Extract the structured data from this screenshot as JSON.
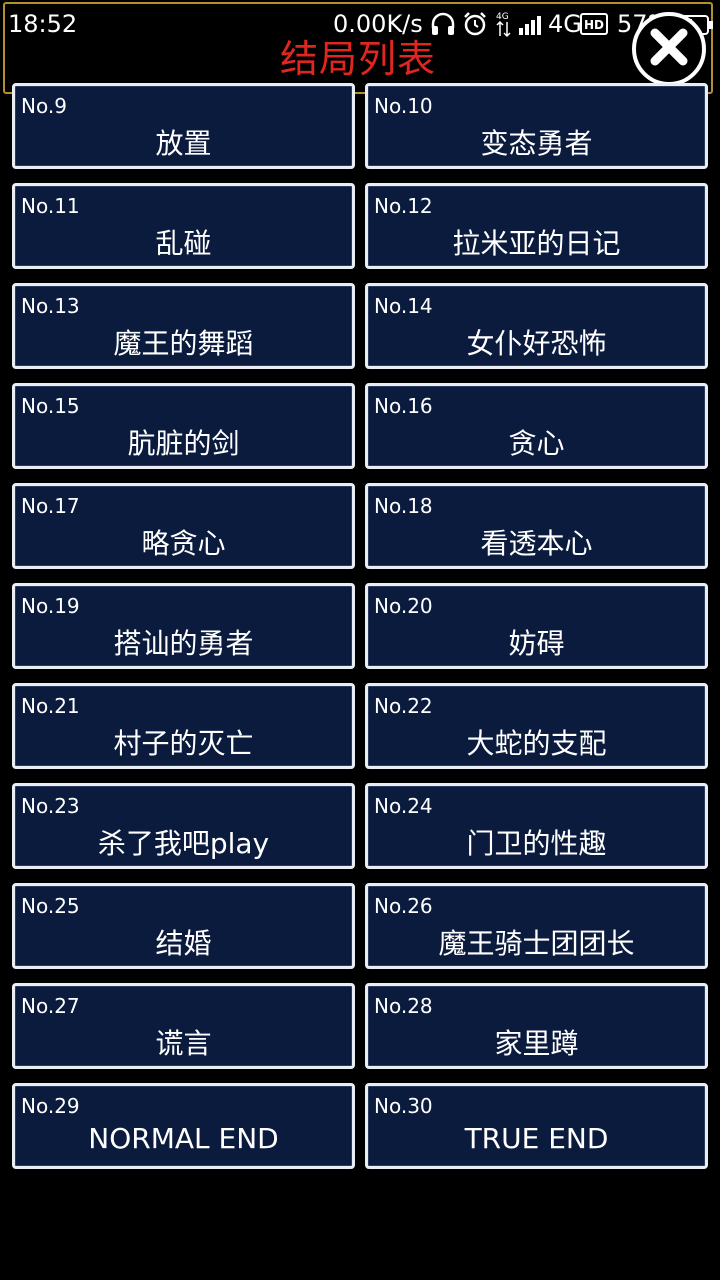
{
  "status_bar": {
    "time": "18:52",
    "net_speed": "0.00K/s",
    "signal_label": "4G",
    "battery": "57%"
  },
  "header": {
    "title": "结局列表"
  },
  "endings": [
    {
      "number": "No.9",
      "name": "放置"
    },
    {
      "number": "No.10",
      "name": "变态勇者"
    },
    {
      "number": "No.11",
      "name": "乱碰"
    },
    {
      "number": "No.12",
      "name": "拉米亚的日记"
    },
    {
      "number": "No.13",
      "name": "魔王的舞蹈"
    },
    {
      "number": "No.14",
      "name": "女仆好恐怖"
    },
    {
      "number": "No.15",
      "name": "肮脏的剑"
    },
    {
      "number": "No.16",
      "name": "贪心"
    },
    {
      "number": "No.17",
      "name": "略贪心"
    },
    {
      "number": "No.18",
      "name": "看透本心"
    },
    {
      "number": "No.19",
      "name": "搭讪的勇者"
    },
    {
      "number": "No.20",
      "name": "妨碍"
    },
    {
      "number": "No.21",
      "name": "村子的灭亡"
    },
    {
      "number": "No.22",
      "name": "大蛇的支配"
    },
    {
      "number": "No.23",
      "name": "杀了我吧play"
    },
    {
      "number": "No.24",
      "name": "门卫的性趣"
    },
    {
      "number": "No.25",
      "name": "结婚"
    },
    {
      "number": "No.26",
      "name": "魔王骑士团团长"
    },
    {
      "number": "No.27",
      "name": "谎言"
    },
    {
      "number": "No.28",
      "name": "家里蹲"
    },
    {
      "number": "No.29",
      "name": "NORMAL END"
    },
    {
      "number": "No.30",
      "name": "TRUE END"
    }
  ],
  "icons": {
    "close": "close-icon",
    "headphones": "headphones-icon",
    "alarm": "alarm-icon",
    "signal": "signal-icon",
    "hd": "hd-icon",
    "battery": "battery-icon"
  },
  "colors": {
    "title": "#e0261f",
    "card_bg": "#0b1b3d",
    "card_border": "#e9edf4",
    "header_border": "#b58f2e"
  }
}
